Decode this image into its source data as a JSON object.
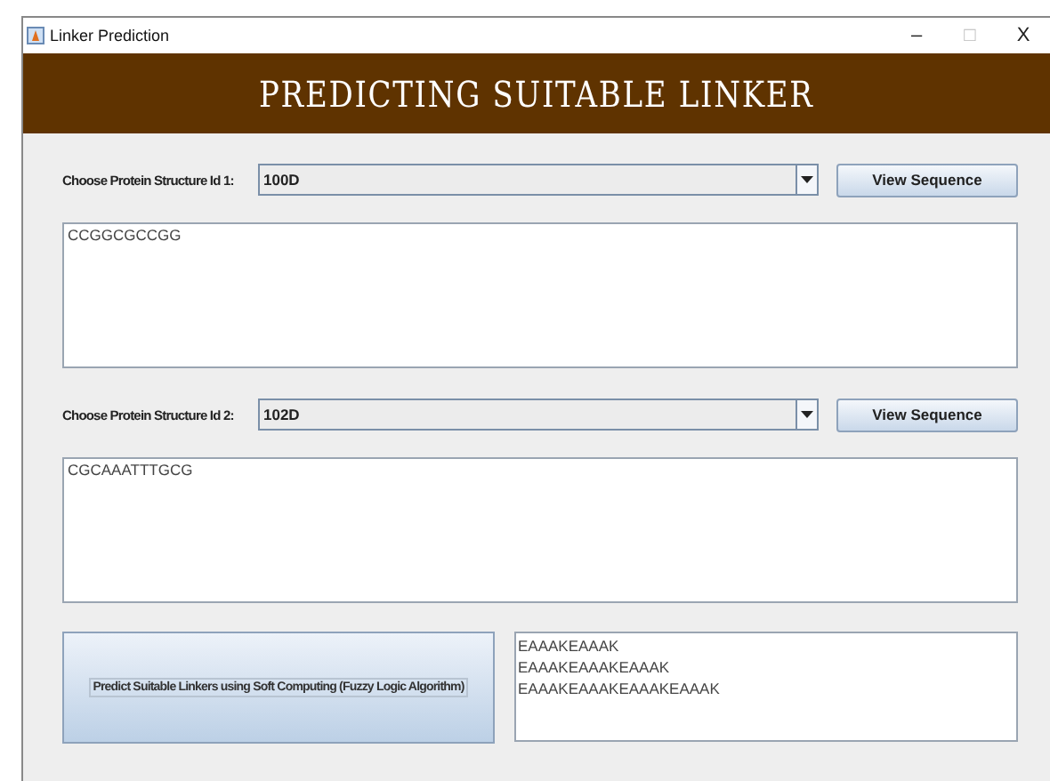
{
  "window": {
    "title": "Linker Prediction",
    "controls": [
      "–",
      "□",
      "X"
    ]
  },
  "header": {
    "title": "PREDICTING SUITABLE LINKER"
  },
  "structures": [
    {
      "label": "Choose Protein Structure Id 1:",
      "value": "100D",
      "button": "View Sequence",
      "sequence": "CCGGCGCCGG"
    },
    {
      "label": "Choose Protein Structure Id 2:",
      "value": "102D",
      "button": "View Sequence",
      "sequence": "CGCAAATTTGCG"
    }
  ],
  "predict": {
    "button": "Predict Suitable Linkers using Soft Computing (Fuzzy Logic Algorithm)",
    "results": [
      "EAAAKEAAAK",
      "EAAAKEAAAKEAAAK",
      "EAAAKEAAAKEAAAKEAAAK"
    ]
  }
}
